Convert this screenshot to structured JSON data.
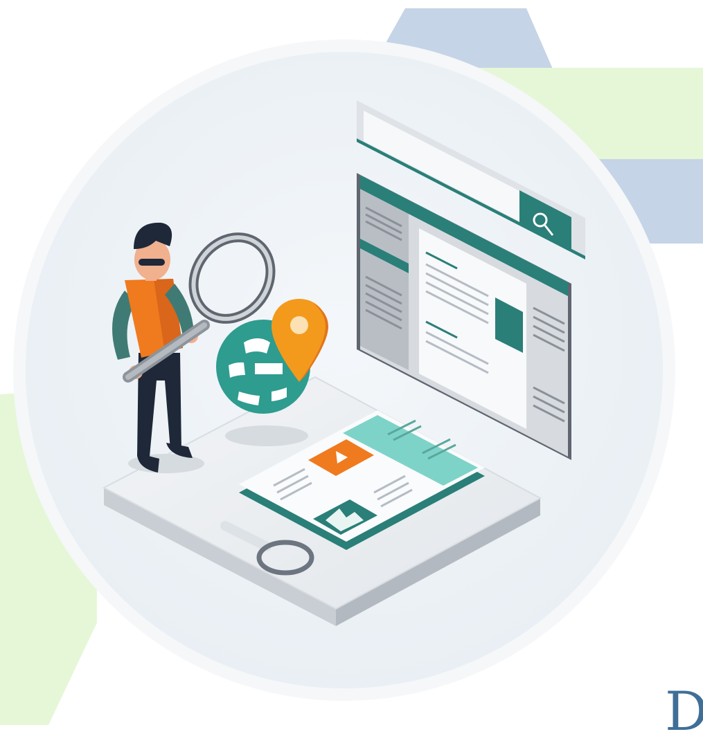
{
  "illustration": {
    "subject": "search-and-web-analysis",
    "colors": {
      "teal": "#2e9c8f",
      "dark_teal": "#2a7f78",
      "light_teal": "#7ed3c8",
      "orange": "#f07a1e",
      "pin_orange": "#f39a1c",
      "navy": "#1e2838",
      "slate": "#5f6670",
      "background_circle": "#eef3f7",
      "blue_band": "#c5d4e6",
      "green_band": "#e6f7d8"
    },
    "icons": [
      "magnifier-icon",
      "globe-icon",
      "location-pin-icon",
      "play-icon",
      "image-icon",
      "search-icon"
    ]
  },
  "brand": {
    "partial_text": "D"
  }
}
